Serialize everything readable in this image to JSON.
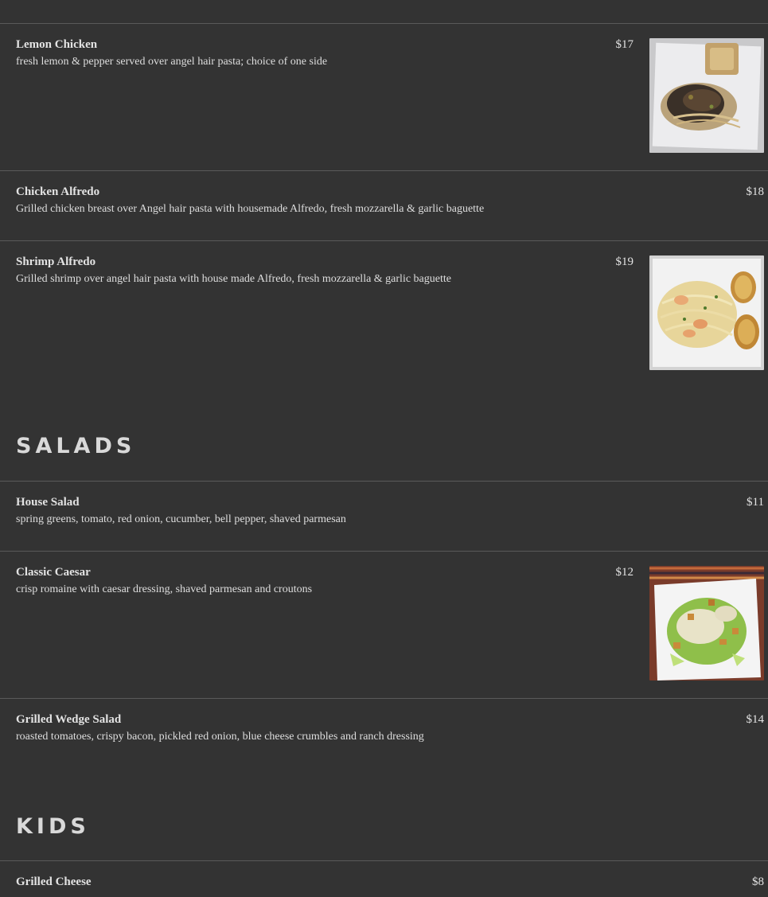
{
  "menu": {
    "top_clipped_text": "· · ·",
    "sections": [
      {
        "items": [
          {
            "name": "Lemon Chicken",
            "description": "fresh lemon & pepper served over angel hair pasta; choice of one side",
            "price": "$17",
            "photo": "lemon-chicken-photo"
          },
          {
            "name": "Chicken Alfredo",
            "description": "Grilled chicken breast over Angel hair pasta with housemade Alfredo, fresh mozzarella & garlic baguette",
            "price": "$18"
          },
          {
            "name": "Shrimp Alfredo",
            "description": "Grilled shrimp over angel hair pasta with house made Alfredo, fresh mozzarella & garlic baguette",
            "price": "$19",
            "photo": "shrimp-alfredo-photo"
          }
        ]
      },
      {
        "title": "SALADS",
        "items": [
          {
            "name": "House Salad",
            "description": "spring greens, tomato, red onion, cucumber, bell pepper, shaved parmesan",
            "price": "$11"
          },
          {
            "name": "Classic Caesar",
            "description": "crisp romaine with caesar dressing, shaved parmesan and croutons",
            "price": "$12",
            "photo": "caesar-salad-photo"
          },
          {
            "name": "Grilled Wedge Salad",
            "description": "roasted tomatoes, crispy bacon, pickled red onion, blue cheese crumbles and ranch dressing",
            "price": "$14"
          }
        ]
      },
      {
        "title": "KIDS",
        "items": [
          {
            "name": "Grilled Cheese",
            "description": "...",
            "price": "$8"
          }
        ]
      }
    ]
  },
  "colors": {
    "background": "#333333",
    "divider": "#5a5a5a",
    "text": "#e3e3e3"
  }
}
